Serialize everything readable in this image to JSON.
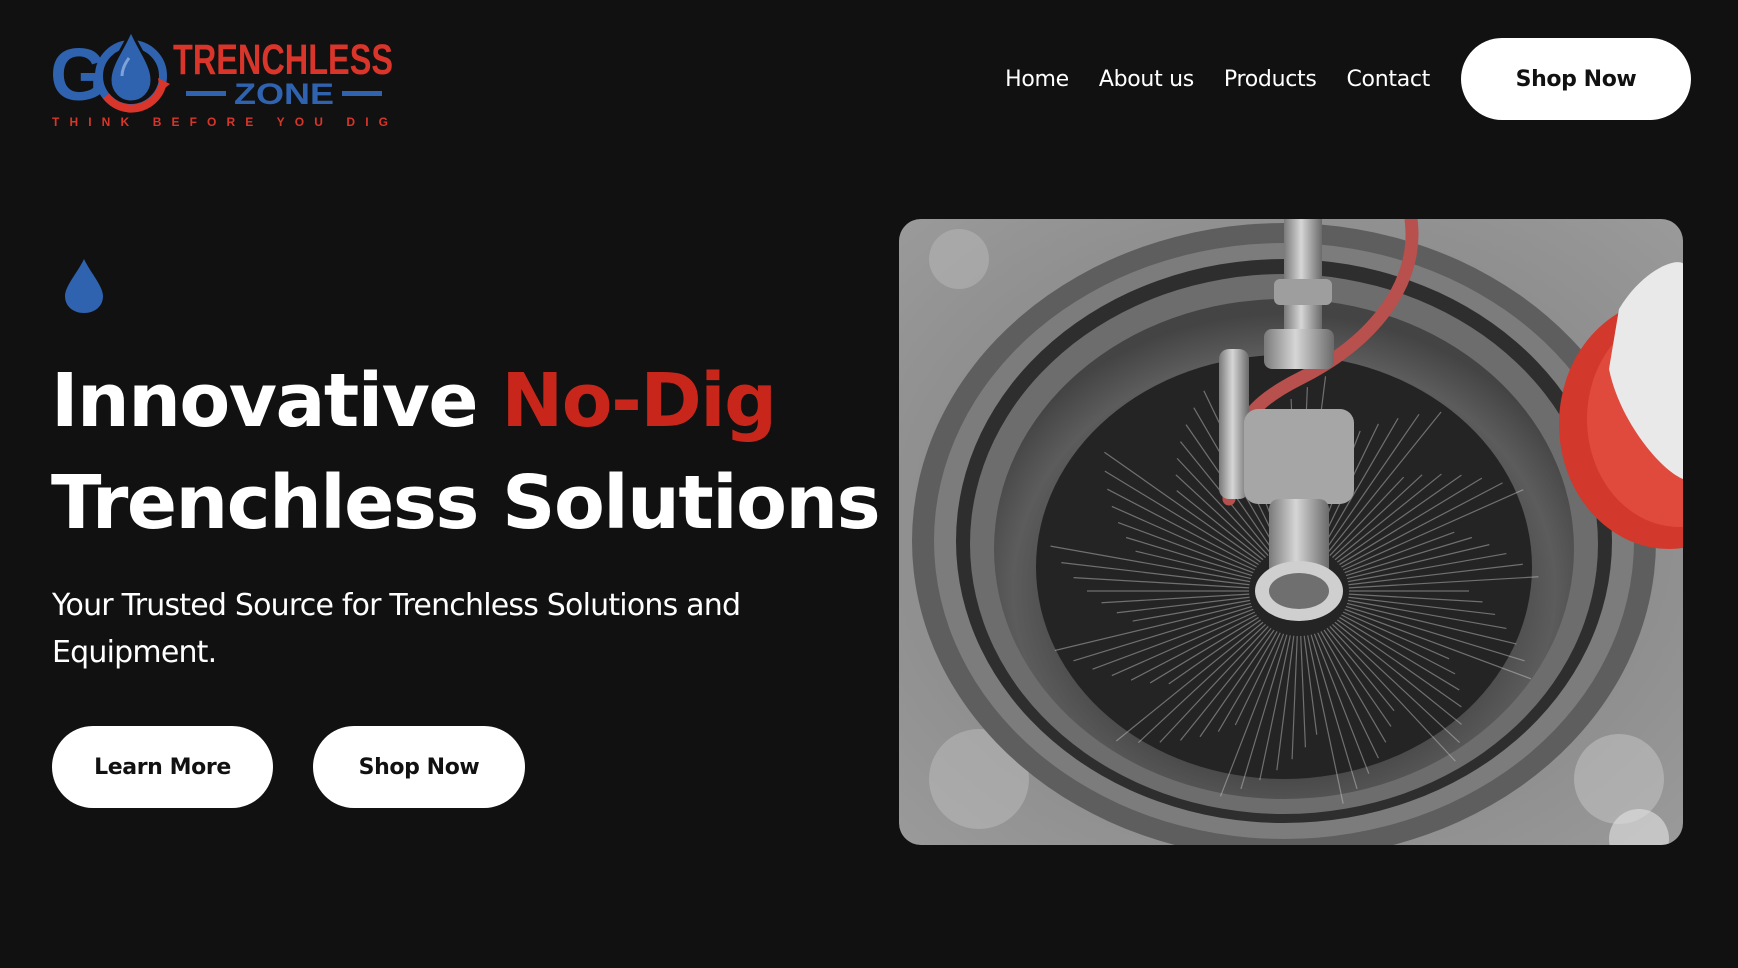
{
  "logo": {
    "letter_g": "G",
    "word_trenchless": "TRENCHLESS",
    "word_zone": "ZONE",
    "tagline": "THINK BEFORE YOU DIG",
    "alt": "Go Trenchless Zone logo"
  },
  "nav": {
    "items": [
      {
        "label": "Home"
      },
      {
        "label": "About us"
      },
      {
        "label": "Products"
      },
      {
        "label": "Contact"
      }
    ],
    "cta_label": "Shop Now"
  },
  "hero": {
    "icon": "water-drop-icon",
    "headline_part1": "Innovative ",
    "headline_accent": "No-Dig",
    "headline_line2": "Trenchless Solutions",
    "subtitle": "Your Trusted Source for Trenchless Solutions and Equipment.",
    "learn_more_label": "Learn More",
    "shop_now_label": "Shop Now",
    "image_description": "High-pressure water jet nozzle spraying inside a manhole pipe"
  },
  "colors": {
    "background": "#111111",
    "accent_red": "#c9261b",
    "brand_blue": "#2f63b0",
    "button_bg": "#ffffff",
    "button_text": "#111111"
  }
}
